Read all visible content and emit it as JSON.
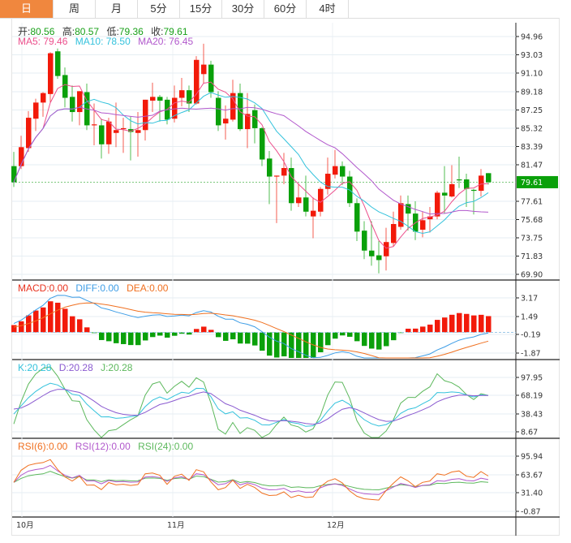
{
  "tabs": [
    "日",
    "周",
    "月",
    "5分",
    "15分",
    "30分",
    "60分",
    "4时"
  ],
  "active_tab": "日",
  "ohlc_legend": {
    "open_label": "开:",
    "open": "80.56",
    "high_label": "高:",
    "high": "80.57",
    "low_label": "低:",
    "low": "79.36",
    "close_label": "收:",
    "close": "79.61"
  },
  "ma_legend": {
    "ma5": "MA5: 79.46",
    "ma10": "MA10: 78.50",
    "ma20": "MA20: 76.45"
  },
  "macd_legend": {
    "macd": "MACD:0.00",
    "diff": "DIFF:0.00",
    "dea": "DEA:0.00"
  },
  "kdj_legend": {
    "k": "K:20.28",
    "d": "D:20.28",
    "j": "J:20.28"
  },
  "rsi_legend": {
    "rsi6": "RSI(6):0.00",
    "rsi12": "RSI(12):0.00",
    "rsi24": "RSI(24):0.00"
  },
  "colors": {
    "up": "#f21a0a",
    "down": "#0aa00a",
    "ma5": "#ec4f8c",
    "ma10": "#33c2dc",
    "ma20": "#b158cc",
    "diff": "#3d9de6",
    "dea": "#f07020",
    "k": "#33c2dc",
    "d": "#8a5ad0",
    "j": "#5cb85c",
    "rsi6": "#f07020",
    "rsi12": "#b158cc",
    "rsi24": "#5cb85c",
    "accent": "#f0873e"
  },
  "chart_data": {
    "type": "candlestick",
    "x_tick_labels": [
      "10月",
      "11月",
      "12月"
    ],
    "current_price": "79.61",
    "price_axis_ticks": [
      "94.96",
      "93.03",
      "91.10",
      "89.18",
      "87.25",
      "85.32",
      "83.39",
      "81.47",
      "77.61",
      "75.68",
      "73.75",
      "71.83",
      "69.90"
    ],
    "ylim": [
      69.9,
      94.96
    ],
    "macd_axis_ticks": [
      "3.17",
      "1.49",
      "-0.19",
      "-1.87"
    ],
    "kdj_axis_ticks": [
      "97.95",
      "68.19",
      "38.43",
      "8.67"
    ],
    "rsi_axis_ticks": [
      "95.94",
      "63.67",
      "31.40",
      "-0.87"
    ],
    "candles_ohlc": [
      [
        81.3,
        82.8,
        79.1,
        79.6
      ],
      [
        81.3,
        84.5,
        81.0,
        83.3
      ],
      [
        83.2,
        87.1,
        82.8,
        86.4
      ],
      [
        86.3,
        88.4,
        85.0,
        88.0
      ],
      [
        88.0,
        89.1,
        86.5,
        89.0
      ],
      [
        88.9,
        93.3,
        88.0,
        93.2
      ],
      [
        93.4,
        93.7,
        90.5,
        90.8
      ],
      [
        90.9,
        91.7,
        87.5,
        88.5
      ],
      [
        88.6,
        89.8,
        86.0,
        87.0
      ],
      [
        87.0,
        89.2,
        85.6,
        89.2
      ],
      [
        89.1,
        90.0,
        85.1,
        85.6
      ],
      [
        85.6,
        87.9,
        83.5,
        85.7
      ],
      [
        85.6,
        86.3,
        82.1,
        83.6
      ],
      [
        83.6,
        86.4,
        82.6,
        86.0
      ],
      [
        84.8,
        88.0,
        83.3,
        85.1
      ],
      [
        85.2,
        86.4,
        82.7,
        85.3
      ],
      [
        85.2,
        86.5,
        81.9,
        84.9
      ],
      [
        84.8,
        87.0,
        82.3,
        85.1
      ],
      [
        85.1,
        88.3,
        84.0,
        88.3
      ],
      [
        88.2,
        90.1,
        87.0,
        88.6
      ],
      [
        88.6,
        88.8,
        86.0,
        88.2
      ],
      [
        88.3,
        88.6,
        85.7,
        86.2
      ],
      [
        86.3,
        89.8,
        85.9,
        88.5
      ],
      [
        88.5,
        90.6,
        87.6,
        89.3
      ],
      [
        89.3,
        89.8,
        87.0,
        87.9
      ],
      [
        87.9,
        92.9,
        87.8,
        92.5
      ],
      [
        91.0,
        94.2,
        90.0,
        92.0
      ],
      [
        92.0,
        92.4,
        88.5,
        89.1
      ],
      [
        88.5,
        89.2,
        85.0,
        85.6
      ],
      [
        85.8,
        87.7,
        84.1,
        86.3
      ],
      [
        86.2,
        90.4,
        86.0,
        89.0
      ],
      [
        89.0,
        90.0,
        85.0,
        85.2
      ],
      [
        85.2,
        89.0,
        83.2,
        86.8
      ],
      [
        87.2,
        87.8,
        83.7,
        85.3
      ],
      [
        85.3,
        85.4,
        81.3,
        82.0
      ],
      [
        82.1,
        82.9,
        77.3,
        80.2
      ],
      [
        80.2,
        80.3,
        75.3,
        80.3
      ],
      [
        80.3,
        82.7,
        79.4,
        81.1
      ],
      [
        81.1,
        82.2,
        76.6,
        77.4
      ],
      [
        77.4,
        79.5,
        77.0,
        78.0
      ],
      [
        78.0,
        80.3,
        76.0,
        76.5
      ],
      [
        76.0,
        78.0,
        73.7,
        76.6
      ],
      [
        76.5,
        79.1,
        76.0,
        78.9
      ],
      [
        78.9,
        82.2,
        78.3,
        80.5
      ],
      [
        80.4,
        83.0,
        80.0,
        81.3
      ],
      [
        81.3,
        81.8,
        79.3,
        80.2
      ],
      [
        80.2,
        80.8,
        77.0,
        77.4
      ],
      [
        77.4,
        77.9,
        73.4,
        74.4
      ],
      [
        74.5,
        75.5,
        71.5,
        72.4
      ],
      [
        72.4,
        75.5,
        70.8,
        71.8
      ],
      [
        71.9,
        73.4,
        70.0,
        71.4
      ],
      [
        71.8,
        74.8,
        70.3,
        73.3
      ],
      [
        73.2,
        76.5,
        72.8,
        75.2
      ],
      [
        74.9,
        78.2,
        74.6,
        77.4
      ],
      [
        77.3,
        78.2,
        74.5,
        76.3
      ],
      [
        76.3,
        77.6,
        73.5,
        74.4
      ],
      [
        74.6,
        76.5,
        73.8,
        75.6
      ],
      [
        75.7,
        77.0,
        74.3,
        76.0
      ],
      [
        76.0,
        78.7,
        75.7,
        78.5
      ],
      [
        78.5,
        81.3,
        76.3,
        78.2
      ],
      [
        78.1,
        81.4,
        78.0,
        79.4
      ],
      [
        79.9,
        82.3,
        79.0,
        79.8
      ],
      [
        79.9,
        80.5,
        77.0,
        78.9
      ],
      [
        78.8,
        78.9,
        76.2,
        78.7
      ],
      [
        78.7,
        81.0,
        78.1,
        80.3
      ],
      [
        80.56,
        80.57,
        79.36,
        79.61
      ]
    ]
  }
}
